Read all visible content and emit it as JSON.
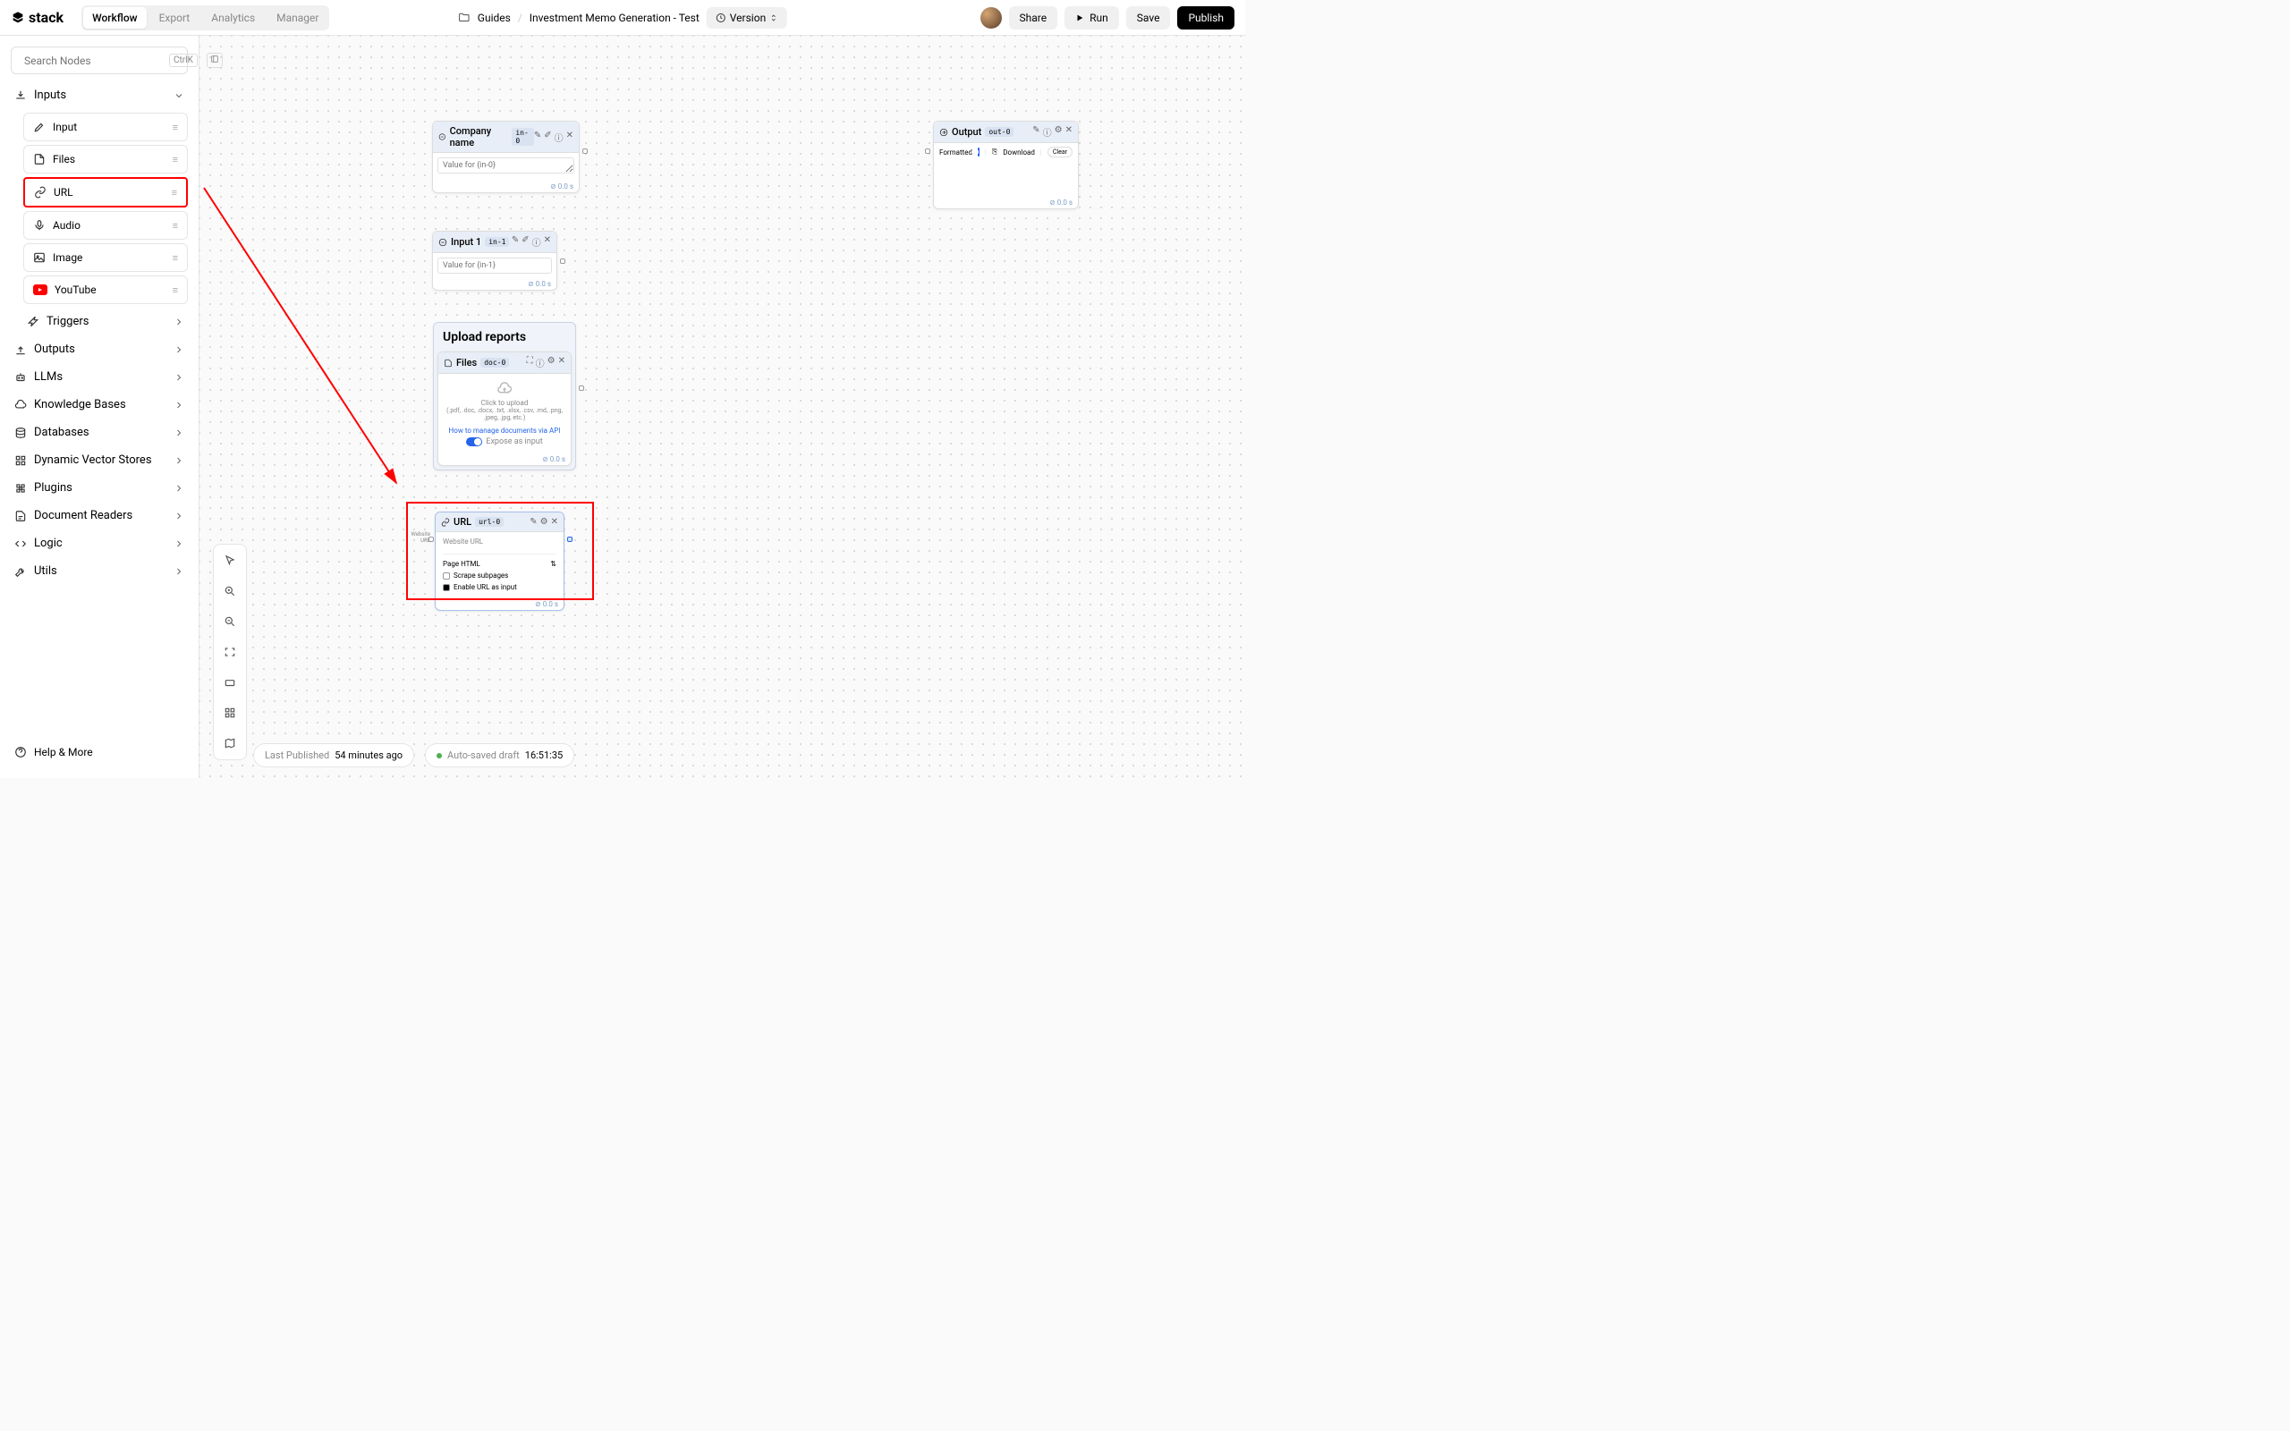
{
  "header": {
    "logo": "stack",
    "tabs": [
      "Workflow",
      "Export",
      "Analytics",
      "Manager"
    ],
    "breadcrumb": {
      "folder": "Guides",
      "file": "Investment Memo Generation - Test"
    },
    "version_label": "Version",
    "share_label": "Share",
    "run_label": "Run",
    "save_label": "Save",
    "publish_label": "Publish"
  },
  "sidebar": {
    "search_placeholder": "Search Nodes",
    "search_shortcut": "CtrlK",
    "categories": {
      "inputs": {
        "label": "Inputs",
        "items": [
          "Input",
          "Files",
          "URL",
          "Audio",
          "Image",
          "YouTube"
        ],
        "trigger": "Triggers"
      },
      "outputs": "Outputs",
      "llms": "LLMs",
      "knowledge": "Knowledge Bases",
      "databases": "Databases",
      "vector": "Dynamic Vector Stores",
      "plugins": "Plugins",
      "readers": "Document Readers",
      "logic": "Logic",
      "utils": "Utils"
    },
    "help": "Help & More"
  },
  "canvas": {
    "node_company": {
      "title": "Company name",
      "badge": "in-0",
      "placeholder": "Value for {in-0}",
      "time": "⊘ 0.0 s"
    },
    "node_input1": {
      "title": "Input 1",
      "badge": "in-1",
      "placeholder": "Value for {in-1}",
      "time": "⊘ 0.0 s"
    },
    "group_title": "Upload reports",
    "node_files": {
      "title": "Files",
      "badge": "doc-0",
      "click": "Click to upload",
      "formats": "(.pdf, .doc, .docx, .txt, .xlsx, .csv, .md, .png, .jpeg, .jpg, etc.)",
      "link": "How to manage documents via API",
      "expose": "Expose as input",
      "time": "⊘ 0.0 s"
    },
    "node_url": {
      "title": "URL",
      "badge": "url-0",
      "label": "Website URL",
      "select": "Page HTML",
      "opt1": "Scrape subpages",
      "opt2": "Enable URL as input",
      "time": "⊘ 0.0 s",
      "port_label": "Website URL"
    },
    "node_output": {
      "title": "Output",
      "badge": "out-0",
      "formatted": "Formatted",
      "download": "Download",
      "clear": "Clear",
      "time": "⊘ 0.0 s"
    }
  },
  "status": {
    "last_pub_label": "Last Published",
    "last_pub_time": "54 minutes ago",
    "autosave_label": "Auto-saved draft",
    "autosave_time": "16:51:35"
  }
}
